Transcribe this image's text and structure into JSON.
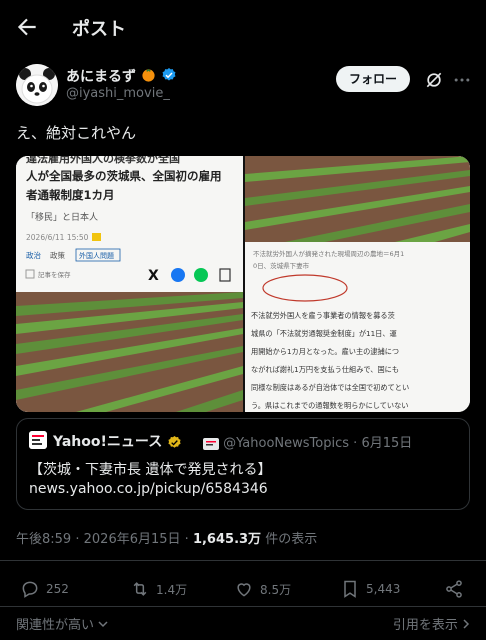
{
  "header": {
    "title": "ポスト",
    "back_icon": "arrow-left-icon"
  },
  "author": {
    "display_name": "あにまるず",
    "handle": "@iyashi_movie_",
    "follow_label": "フォロー",
    "badge_color": "#1d9bf0",
    "orange_badge_color": "#f4900c"
  },
  "tweet": {
    "text": "え、絶対これやん"
  },
  "media": {
    "left": {
      "headline_1": "人が全国最多の茨城県、全国初の雇用",
      "headline_2": "者通報制度1カ月",
      "quote_line": "「移民」と日本人",
      "date": "2026/6/11 15:50",
      "tag_1": "政治",
      "tag_2": "政策",
      "tag_3": "外国人問題",
      "save_label": "記事を保存"
    },
    "right": {
      "caption_1": "不法就労外国人が摘発された現場周辺の農地＝6月1",
      "caption_2": "0日、茨城県下妻市",
      "body_1": "不法就労外国人を雇う事業者の情報を募る茨",
      "body_2": "城県の「不法就労通報奨金制度」が11日、運",
      "body_3": "用開始から1カ月となった。雇い主の逮捕につ",
      "body_4": "ながれば謝礼1万円を支払う仕組みで、国にも",
      "body_5": "同様な制度はあるが自治体では全国で初めてとい",
      "body_6": "う。県はこれまでの通報数を明らかにしていない"
    }
  },
  "quote": {
    "name": "Yahoo!ニュース",
    "handle": "@YahooNewsTopics",
    "dot": "·",
    "date": "6月15日",
    "line1": "【茨城・下妻市長 遺体で発見される】",
    "line2": "news.yahoo.co.jp/pickup/6584346",
    "badge_color": "#e2b719"
  },
  "meta": {
    "time": "午後8:59",
    "dot": "·",
    "date": "2026年6月15日",
    "views_count": "1,645.3万",
    "views_label": "件の表示"
  },
  "actions": {
    "replies": "252",
    "reposts": "1.4万",
    "likes": "8.5万",
    "bookmarks": "5,443"
  },
  "footer": {
    "sort_label": "関連性が高い",
    "quotes_label": "引用を表示"
  }
}
